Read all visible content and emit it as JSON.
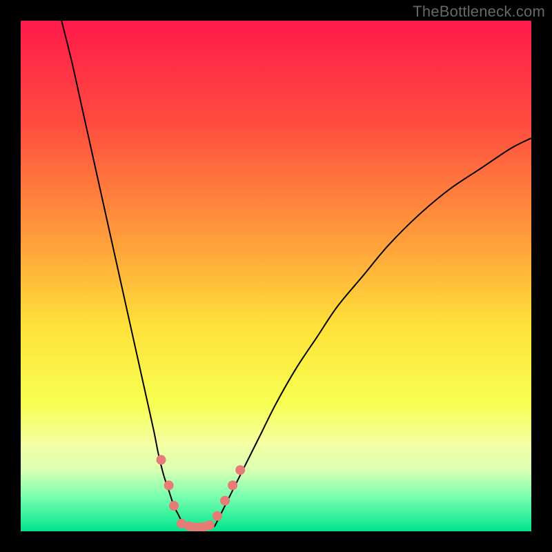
{
  "watermark": "TheBottleneck.com",
  "chart_data": {
    "type": "line",
    "title": "",
    "xlabel": "",
    "ylabel": "",
    "xlim": [
      0,
      100
    ],
    "ylim": [
      0,
      100
    ],
    "grid": false,
    "legend": false,
    "background_gradient": {
      "stops": [
        {
          "pct": 0,
          "color": "#ff1a4b"
        },
        {
          "pct": 20,
          "color": "#ff4c3f"
        },
        {
          "pct": 45,
          "color": "#ffa63b"
        },
        {
          "pct": 60,
          "color": "#ffe239"
        },
        {
          "pct": 75,
          "color": "#f7ff52"
        },
        {
          "pct": 83,
          "color": "#f3ffa5"
        },
        {
          "pct": 88,
          "color": "#d9ffb3"
        },
        {
          "pct": 93,
          "color": "#7cffb0"
        },
        {
          "pct": 100,
          "color": "#00e58c"
        }
      ]
    },
    "series": [
      {
        "name": "left-branch",
        "color": "#000000",
        "x": [
          8,
          10,
          12,
          14,
          16,
          18,
          20,
          22,
          24,
          26,
          27,
          28,
          29,
          30,
          31,
          32
        ],
        "y": [
          100,
          92,
          83,
          74,
          65,
          56,
          47,
          38,
          29,
          20,
          15,
          11,
          8,
          5,
          3,
          1
        ]
      },
      {
        "name": "right-branch",
        "color": "#000000",
        "x": [
          38,
          39,
          40,
          42,
          44,
          47,
          50,
          54,
          58,
          62,
          67,
          72,
          78,
          84,
          90,
          96,
          100
        ],
        "y": [
          1,
          3,
          5,
          9,
          13,
          19,
          25,
          32,
          38,
          44,
          50,
          56,
          62,
          67,
          71,
          75,
          77
        ]
      },
      {
        "name": "valley-floor",
        "color": "#000000",
        "x": [
          32,
          33,
          34,
          35,
          36,
          37,
          38
        ],
        "y": [
          1,
          0.5,
          0.3,
          0.25,
          0.3,
          0.5,
          1
        ]
      }
    ],
    "markers": {
      "name": "highlight-dots",
      "color": "#e77b76",
      "points": [
        {
          "x": 27.5,
          "y": 14
        },
        {
          "x": 29.0,
          "y": 9
        },
        {
          "x": 30.0,
          "y": 5
        },
        {
          "x": 31.5,
          "y": 1.5
        },
        {
          "x": 33.0,
          "y": 1
        },
        {
          "x": 34.0,
          "y": 0.8
        },
        {
          "x": 35.0,
          "y": 0.8
        },
        {
          "x": 36.0,
          "y": 0.9
        },
        {
          "x": 37.0,
          "y": 1.2
        },
        {
          "x": 38.5,
          "y": 3
        },
        {
          "x": 40.0,
          "y": 6
        },
        {
          "x": 41.5,
          "y": 9
        },
        {
          "x": 43.0,
          "y": 12
        }
      ],
      "radius": 7
    }
  }
}
